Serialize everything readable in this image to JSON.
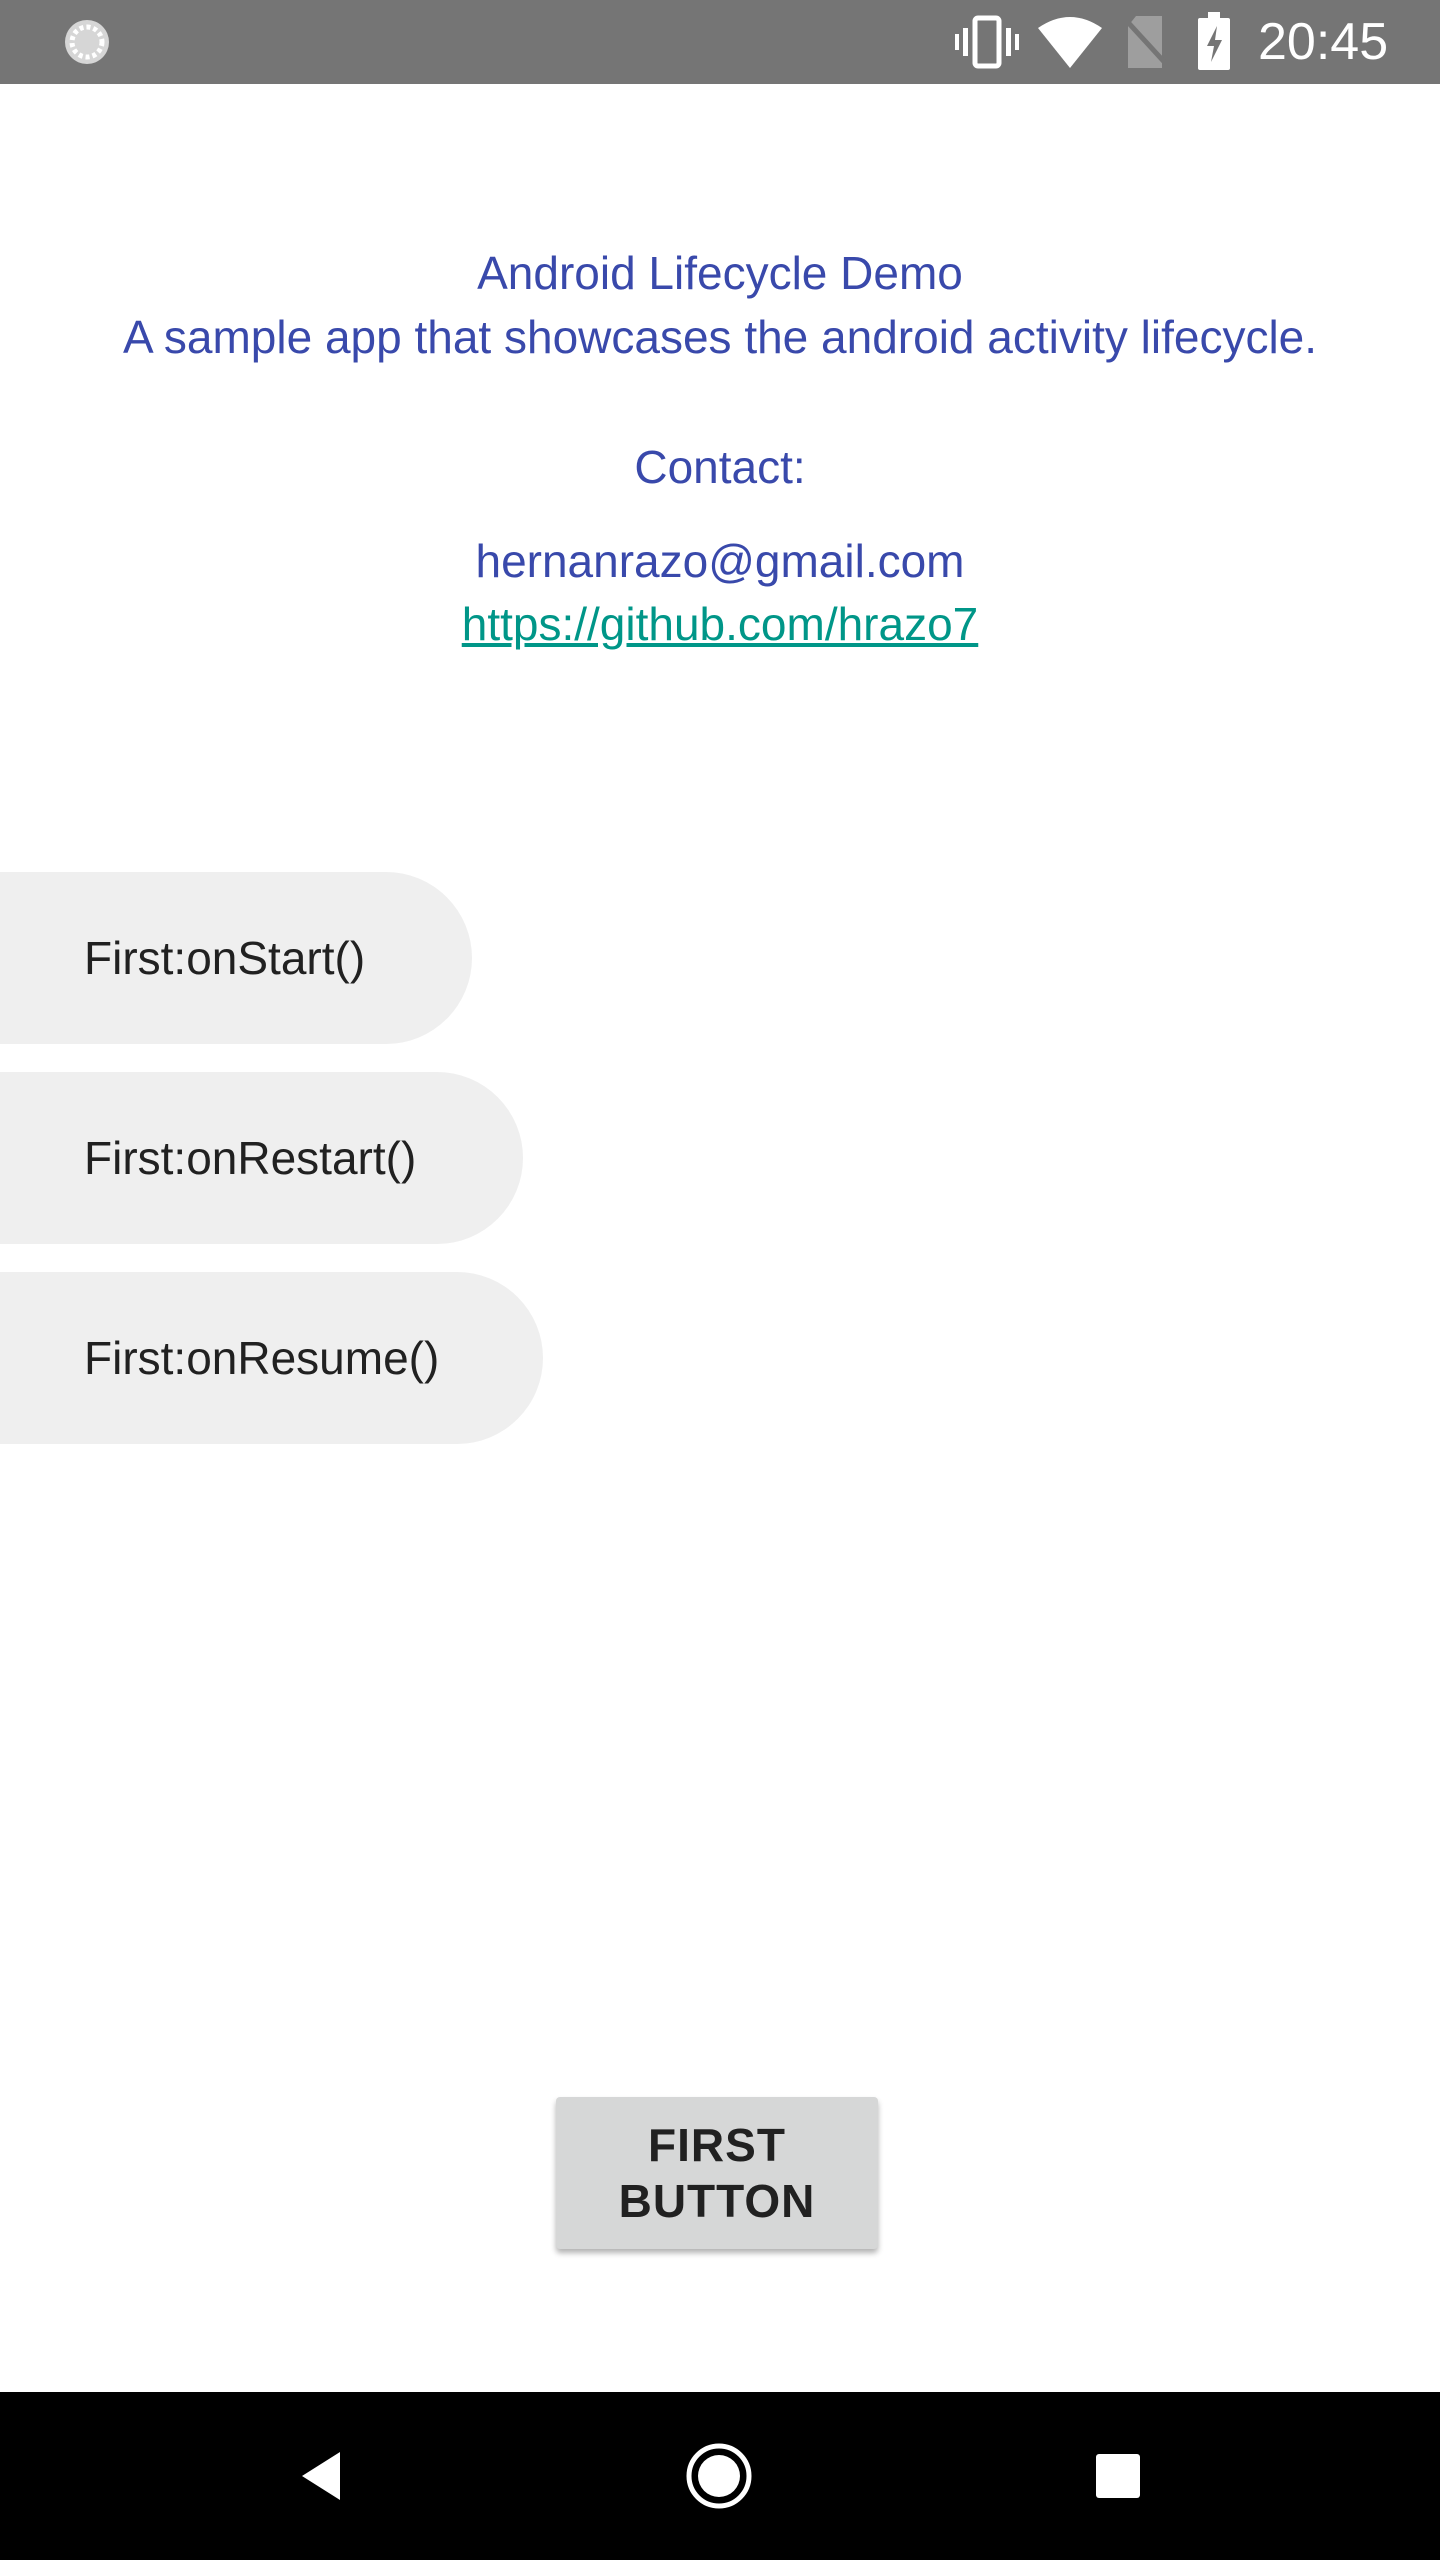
{
  "status_bar": {
    "time": "20:45",
    "icons": [
      "sync-icon",
      "vibrate-icon",
      "wifi-icon",
      "no-sim-icon",
      "battery-charging-icon"
    ]
  },
  "header": {
    "title": "Android Lifecycle Demo",
    "description": "A sample app that showcases the android activity lifecycle.",
    "contact_label": "Contact:",
    "email": "hernanrazo@gmail.com",
    "link": "https://github.com/hrazo7"
  },
  "lifecycle_events": [
    {
      "label": "First:onStart()"
    },
    {
      "label": "First:onRestart()"
    },
    {
      "label": "First:onResume()"
    }
  ],
  "first_button": {
    "label": "FIRST BUTTON"
  },
  "nav_bar": {
    "icons": [
      "back-icon",
      "home-icon",
      "recents-icon"
    ]
  },
  "colors": {
    "status_bar": "#757575",
    "text_primary": "#3949ab",
    "link": "#009688",
    "pill_background": "#efefef",
    "button_background": "#d6d7d7",
    "nav_bar": "#000000"
  }
}
